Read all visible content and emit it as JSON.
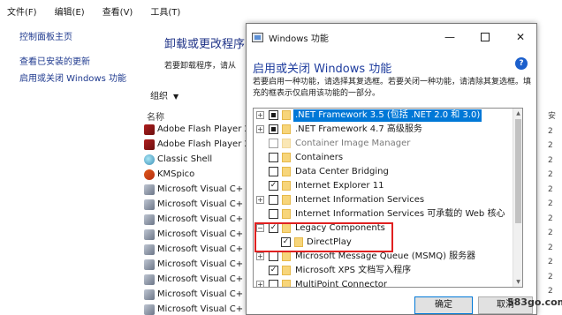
{
  "menubar": {
    "file": "文件(F)",
    "edit": "编辑(E)",
    "view": "查看(V)",
    "tools": "工具(T)"
  },
  "sidebar": {
    "home": "控制面板主页",
    "installed_updates": "查看已安装的更新",
    "windows_features": "启用或关闭 Windows 功能"
  },
  "background": {
    "title": "卸载或更改程序",
    "subtitle": "若要卸载程序，请从",
    "organize": "组织",
    "column_name": "名称",
    "right_col_header": "安",
    "right_col_values": [
      "2",
      "2",
      "2",
      "2",
      "2",
      "2",
      "2",
      "2",
      "2",
      "2",
      "2",
      "2"
    ],
    "programs": [
      {
        "name": "Adobe Flash Player 2",
        "icon": "flash-icon"
      },
      {
        "name": "Adobe Flash Player 2",
        "icon": "flash-icon"
      },
      {
        "name": "Classic Shell",
        "icon": "shell-icon"
      },
      {
        "name": "KMSpico",
        "icon": "kms-icon"
      },
      {
        "name": "Microsoft Visual C+",
        "icon": "installer-icon"
      },
      {
        "name": "Microsoft Visual C+",
        "icon": "installer-icon"
      },
      {
        "name": "Microsoft Visual C+",
        "icon": "installer-icon"
      },
      {
        "name": "Microsoft Visual C+",
        "icon": "installer-icon"
      },
      {
        "name": "Microsoft Visual C+",
        "icon": "installer-icon"
      },
      {
        "name": "Microsoft Visual C+",
        "icon": "installer-icon"
      },
      {
        "name": "Microsoft Visual C+",
        "icon": "installer-icon"
      },
      {
        "name": "Microsoft Visual C+",
        "icon": "installer-icon"
      },
      {
        "name": "Microsoft Visual C+",
        "icon": "installer-icon"
      }
    ]
  },
  "dialog": {
    "title": "Windows 功能",
    "heading": "启用或关闭 Windows 功能",
    "help": "?",
    "description": "若要启用一种功能，请选择其复选框。若要关闭一种功能，请清除其复选框。填充的框表示仅启用该功能的一部分。",
    "features": [
      {
        "label": ".NET Framework 3.5 (包括 .NET 2.0 和 3.0)",
        "state": "partial",
        "expandable": true,
        "selected": true
      },
      {
        "label": ".NET Framework 4.7 高级服务",
        "state": "partial",
        "expandable": true
      },
      {
        "label": "Container Image Manager",
        "state": "unchecked",
        "expandable": false,
        "dim": true
      },
      {
        "label": "Containers",
        "state": "unchecked",
        "expandable": false
      },
      {
        "label": "Data Center Bridging",
        "state": "unchecked",
        "expandable": false
      },
      {
        "label": "Internet Explorer 11",
        "state": "checked",
        "expandable": false
      },
      {
        "label": "Internet Information Services",
        "state": "unchecked",
        "expandable": true
      },
      {
        "label": "Internet Information Services 可承载的 Web 核心",
        "state": "unchecked",
        "expandable": false
      },
      {
        "label": "Legacy Components",
        "state": "checked",
        "expandable": true,
        "expanded": true
      },
      {
        "label": "DirectPlay",
        "state": "checked",
        "expandable": false,
        "child": true
      },
      {
        "label": "Microsoft Message Queue (MSMQ) 服务器",
        "state": "unchecked",
        "expandable": true
      },
      {
        "label": "Microsoft XPS 文档写入程序",
        "state": "checked",
        "expandable": false
      },
      {
        "label": "MultiPoint Connector",
        "state": "unchecked",
        "expandable": true
      }
    ],
    "ok_label": "确定",
    "cancel_label": "取消"
  },
  "watermark": "583go.com",
  "colors": {
    "accent": "#0078d7",
    "highlight": "#e02020",
    "link": "#1f3a8f"
  }
}
